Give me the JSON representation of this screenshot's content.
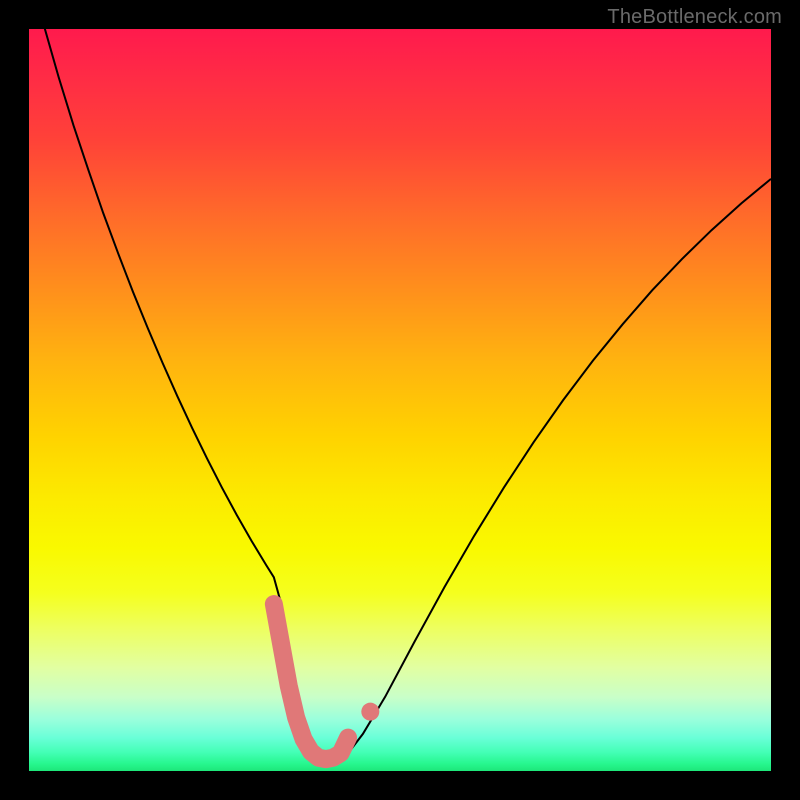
{
  "watermark": "TheBottleneck.com",
  "chart_data": {
    "type": "line",
    "title": "",
    "xlabel": "",
    "ylabel": "",
    "xlim": [
      0,
      100
    ],
    "ylim": [
      0,
      100
    ],
    "grid": false,
    "series": [
      {
        "name": "curve",
        "stroke": "#000000",
        "x": [
          0,
          2,
          4,
          6,
          8,
          10,
          12,
          14,
          16,
          18,
          20,
          22,
          24,
          26,
          28,
          30,
          32,
          33,
          34,
          35,
          36,
          37,
          38,
          39,
          40,
          41,
          42,
          43,
          45,
          48,
          52,
          56,
          60,
          64,
          68,
          72,
          76,
          80,
          84,
          88,
          92,
          96,
          100
        ],
        "y": [
          108,
          100.5,
          93.5,
          87,
          81,
          75.2,
          69.8,
          64.6,
          59.7,
          55,
          50.5,
          46.2,
          42.1,
          38.2,
          34.5,
          31,
          27.7,
          26.1,
          22.5,
          17,
          11.5,
          7.2,
          4.3,
          2.6,
          1.8,
          1.6,
          1.8,
          2.4,
          5,
          10,
          17.5,
          24.8,
          31.7,
          38.2,
          44.3,
          50,
          55.3,
          60.2,
          64.8,
          69,
          72.9,
          76.5,
          79.8
        ]
      },
      {
        "name": "marker-thick",
        "stroke": "#e07878",
        "strokeWidth": 18,
        "linecap": "round",
        "x": [
          33,
          34,
          35,
          36,
          37,
          38,
          39,
          40,
          41,
          42,
          43
        ],
        "y": [
          22.5,
          17,
          11.5,
          7.2,
          4.3,
          2.6,
          1.8,
          1.6,
          1.8,
          2.4,
          4.5
        ]
      },
      {
        "name": "marker-dot",
        "stroke": "#e07878",
        "dot": true,
        "r": 9,
        "x": [
          46
        ],
        "y": [
          8
        ]
      }
    ],
    "background_gradient": {
      "direction": "vertical",
      "stops": [
        {
          "pos": 0.0,
          "color": "#ff1a4d"
        },
        {
          "pos": 0.15,
          "color": "#ff4238"
        },
        {
          "pos": 0.35,
          "color": "#ff8f1c"
        },
        {
          "pos": 0.55,
          "color": "#ffd300"
        },
        {
          "pos": 0.7,
          "color": "#f9f900"
        },
        {
          "pos": 0.86,
          "color": "#e2ffa1"
        },
        {
          "pos": 0.95,
          "color": "#6affd8"
        },
        {
          "pos": 1.0,
          "color": "#1de779"
        }
      ]
    }
  }
}
